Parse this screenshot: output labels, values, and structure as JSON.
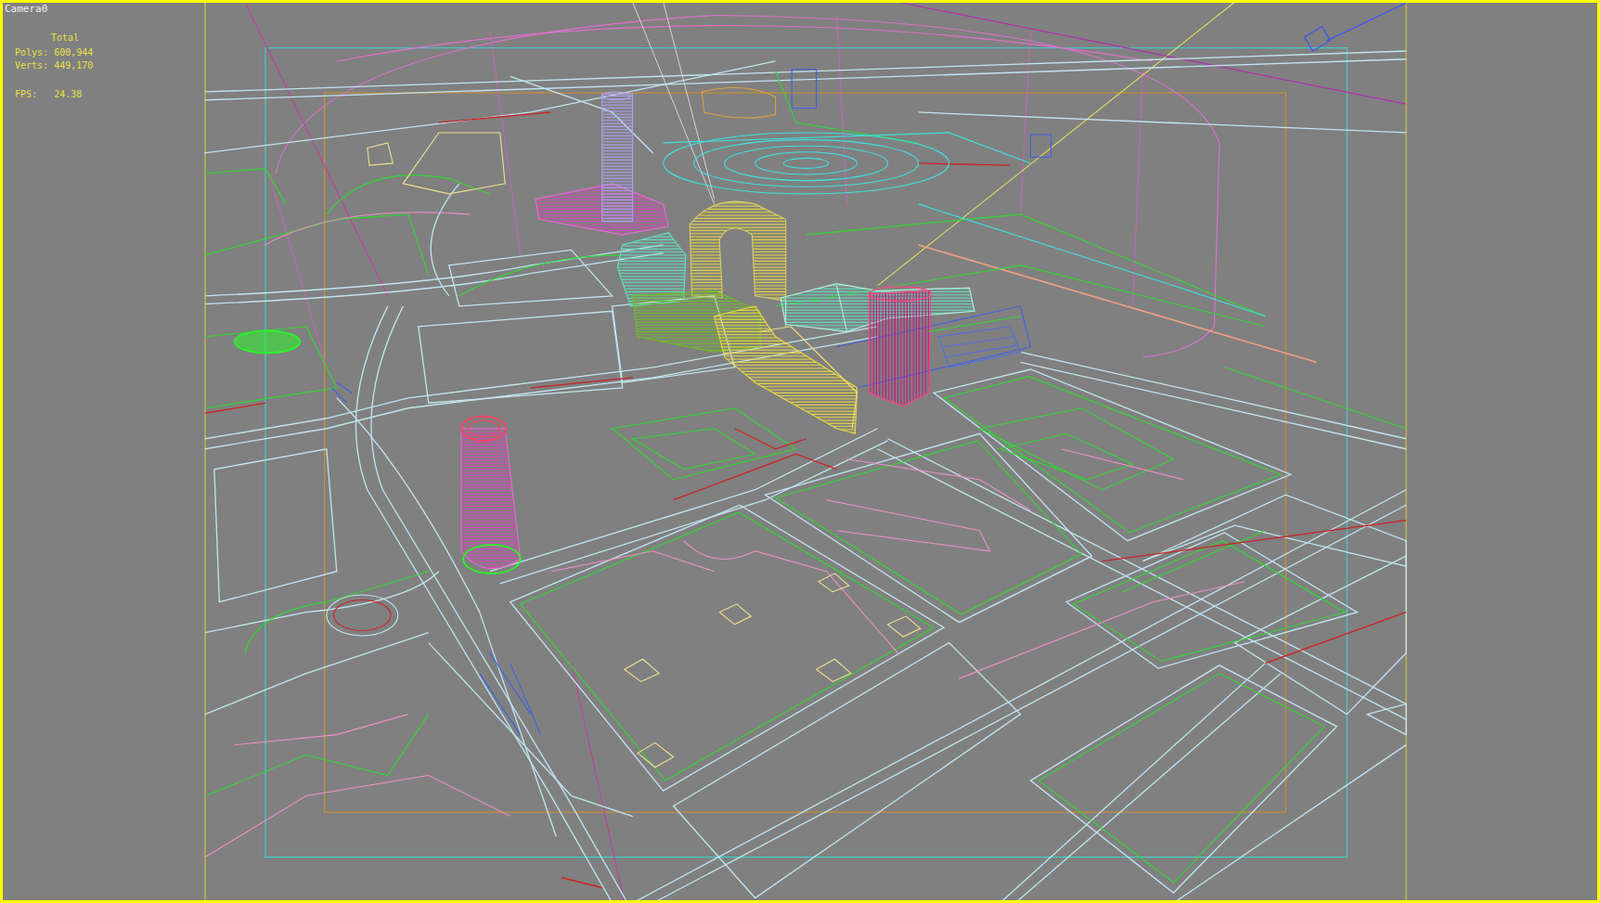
{
  "viewport": {
    "label": "Camera0",
    "active": true
  },
  "stats": {
    "title": "Total",
    "polys": "Polys: 600,944",
    "verts": "Verts: 449,170",
    "fps": "FPS:   24.38"
  }
}
